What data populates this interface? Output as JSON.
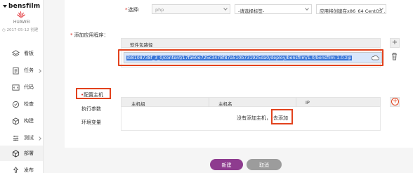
{
  "sidebar": {
    "brand": "bensfilm",
    "org": "HUAWEI",
    "created": "2017-05-12 创建",
    "items": [
      {
        "label": "看板",
        "icon": "dashboard-icon",
        "chevron": false
      },
      {
        "label": "任务",
        "icon": "task-icon",
        "chevron": true
      },
      {
        "label": "代码",
        "icon": "code-icon",
        "chevron": false
      },
      {
        "label": "检查",
        "icon": "check-icon",
        "chevron": false
      },
      {
        "label": "构建",
        "icon": "build-icon",
        "chevron": false
      },
      {
        "label": "测试",
        "icon": "test-icon",
        "chevron": true
      },
      {
        "label": "部署",
        "icon": "deploy-icon",
        "chevron": false
      },
      {
        "label": "发布",
        "icon": "publish-icon",
        "chevron": false
      }
    ],
    "active_index": 6
  },
  "top_select": {
    "label": "选择:",
    "type_value": "php",
    "tag_placeholder": "-请选择标签-",
    "app_value": "应用将创建在x86_64 CentOS ..."
  },
  "add_app": {
    "label": "添加应用程序：",
    "column_header": "软件包路径",
    "path_value": "ib8108738f_3_0/content/17fa60e725c3478f87a510b731925da0/deploy/bensfilm/1.0/bensfilm-1.0.zip"
  },
  "host_config": {
    "tabs": [
      "配置主机",
      "执行参数",
      "环境变量"
    ],
    "columns": [
      "主机组",
      "主机名",
      "IP"
    ],
    "empty_text": "没有添加主机，",
    "add_link": "去添加"
  },
  "buttons": {
    "create": "新建",
    "cancel": "取消"
  },
  "colors": {
    "primary": "#8e3c8f",
    "highlight": "#e2421d",
    "required": "#d93026"
  }
}
